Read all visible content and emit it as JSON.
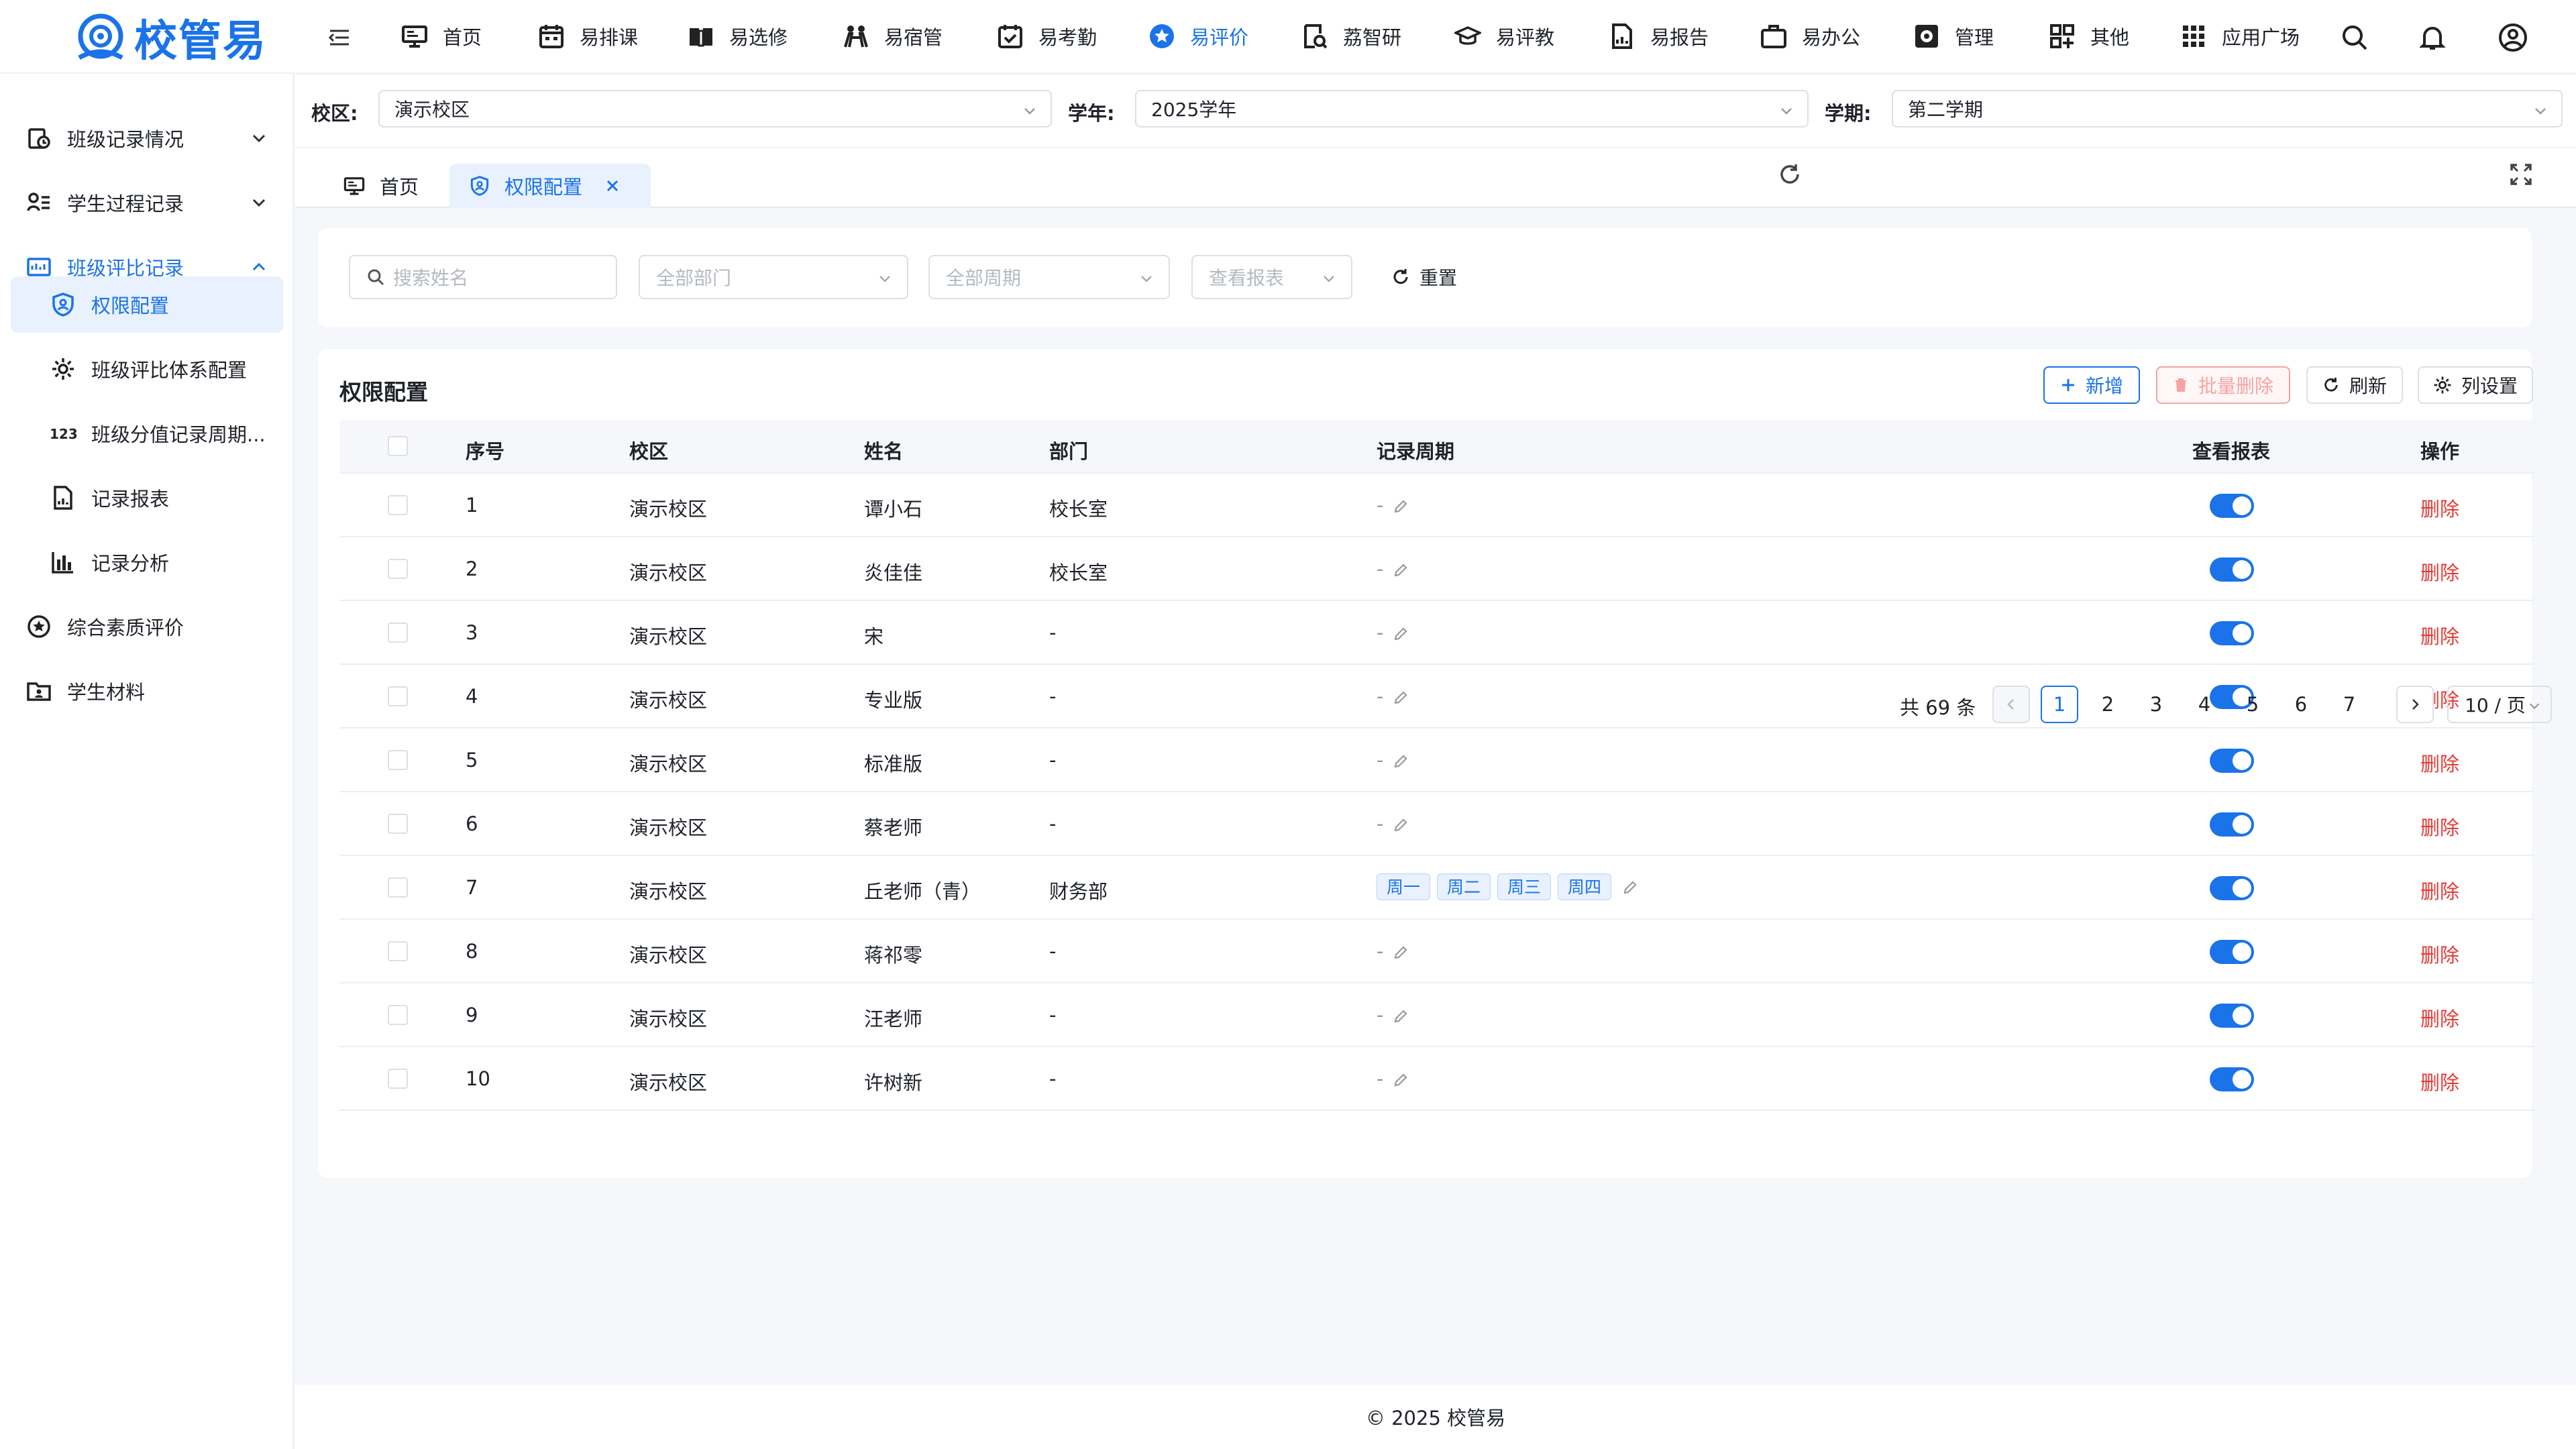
{
  "app": {
    "logo_text": "校管易"
  },
  "topnav": {
    "items": [
      {
        "label": "首页",
        "icon": "monitor-icon"
      },
      {
        "label": "易排课",
        "icon": "calendar-icon"
      },
      {
        "label": "易选修",
        "icon": "book-icon"
      },
      {
        "label": "易宿管",
        "icon": "dorm-icon"
      },
      {
        "label": "易考勤",
        "icon": "calendar-check-icon"
      },
      {
        "label": "易评价",
        "icon": "star-circle-icon",
        "active": true
      },
      {
        "label": "荔智研",
        "icon": "research-icon"
      },
      {
        "label": "易评教",
        "icon": "graduation-cap-icon"
      },
      {
        "label": "易报告",
        "icon": "report-icon"
      },
      {
        "label": "易办公",
        "icon": "briefcase-icon"
      },
      {
        "label": "管理",
        "icon": "settings-box-icon"
      },
      {
        "label": "其他",
        "icon": "grid-plus-icon"
      },
      {
        "label": "应用广场",
        "icon": "apps-grid-icon"
      }
    ],
    "right_icons": [
      "search-icon",
      "bell-icon",
      "user-circle-icon"
    ]
  },
  "sidebar": {
    "items": [
      {
        "label": "班级记录情况",
        "icon": "clipboard-clock-icon",
        "level": 1,
        "expand": "down"
      },
      {
        "label": "学生过程记录",
        "icon": "user-list-icon",
        "level": 1,
        "expand": "down"
      },
      {
        "label": "班级评比记录",
        "icon": "scoreboard-icon",
        "level": 1,
        "expand": "up",
        "active": true
      },
      {
        "label": "权限配置",
        "icon": "shield-user-icon",
        "level": 2,
        "selected": true
      },
      {
        "label": "班级评比体系配置",
        "icon": "gear-icon",
        "level": 2
      },
      {
        "label": "班级分值记录周期...",
        "icon": "numbers-icon",
        "level": 2
      },
      {
        "label": "记录报表",
        "icon": "file-chart-icon",
        "level": 2
      },
      {
        "label": "记录分析",
        "icon": "bar-chart-icon",
        "level": 2
      },
      {
        "label": "综合素质评价",
        "icon": "star-outline-icon",
        "level": 1
      },
      {
        "label": "学生材料",
        "icon": "folder-user-icon",
        "level": 1
      }
    ]
  },
  "filters": {
    "campus": {
      "label": "校区:",
      "value": "演示校区"
    },
    "year": {
      "label": "学年:",
      "value": "2025学年"
    },
    "term": {
      "label": "学期:",
      "value": "第二学期"
    }
  },
  "tabs": [
    {
      "label": "首页",
      "icon": "monitor-icon"
    },
    {
      "label": "权限配置",
      "icon": "shield-user-icon",
      "active": true,
      "closable": true
    }
  ],
  "search": {
    "name_placeholder": "搜索姓名",
    "dept_placeholder": "全部部门",
    "period_placeholder": "全部周期",
    "report_placeholder": "查看报表",
    "reset_label": "重置"
  },
  "table": {
    "title": "权限配置",
    "buttons": {
      "add": "新增",
      "batch_delete": "批量删除",
      "refresh": "刷新",
      "columns": "列设置"
    },
    "headers": {
      "index": "序号",
      "campus": "校区",
      "name": "姓名",
      "dept": "部门",
      "period": "记录周期",
      "report": "查看报表",
      "action": "操作"
    },
    "rows": [
      {
        "index": "1",
        "campus": "演示校区",
        "name": "谭小石",
        "dept": "校长室",
        "period": "-",
        "tags": [],
        "report_on": true,
        "action": "删除"
      },
      {
        "index": "2",
        "campus": "演示校区",
        "name": "炎佳佳",
        "dept": "校长室",
        "period": "-",
        "tags": [],
        "report_on": true,
        "action": "删除"
      },
      {
        "index": "3",
        "campus": "演示校区",
        "name": "宋",
        "dept": "-",
        "period": "-",
        "tags": [],
        "report_on": true,
        "action": "删除"
      },
      {
        "index": "4",
        "campus": "演示校区",
        "name": "专业版",
        "dept": "-",
        "period": "-",
        "tags": [],
        "report_on": true,
        "action": "删除"
      },
      {
        "index": "5",
        "campus": "演示校区",
        "name": "标准版",
        "dept": "-",
        "period": "-",
        "tags": [],
        "report_on": true,
        "action": "删除"
      },
      {
        "index": "6",
        "campus": "演示校区",
        "name": "蔡老师",
        "dept": "-",
        "period": "-",
        "tags": [],
        "report_on": true,
        "action": "删除"
      },
      {
        "index": "7",
        "campus": "演示校区",
        "name": "丘老师（青）",
        "dept": "财务部",
        "period": "",
        "tags": [
          "周一",
          "周二",
          "周三",
          "周四"
        ],
        "report_on": true,
        "action": "删除"
      },
      {
        "index": "8",
        "campus": "演示校区",
        "name": "蒋祁零",
        "dept": "-",
        "period": "-",
        "tags": [],
        "report_on": true,
        "action": "删除"
      },
      {
        "index": "9",
        "campus": "演示校区",
        "name": "汪老师",
        "dept": "-",
        "period": "-",
        "tags": [],
        "report_on": true,
        "action": "删除"
      },
      {
        "index": "10",
        "campus": "演示校区",
        "name": "许树新",
        "dept": "-",
        "period": "-",
        "tags": [],
        "report_on": true,
        "action": "删除"
      }
    ]
  },
  "pagination": {
    "total_text": "共 69 条",
    "pages": [
      "1",
      "2",
      "3",
      "4",
      "5",
      "6",
      "7"
    ],
    "current": "1",
    "page_size": "10 / 页"
  },
  "footer": {
    "text": "© 2025 校管易"
  },
  "colors": {
    "accent": "#1a73e8",
    "danger": "#e53935",
    "tag_bg": "#e8f1fd"
  }
}
